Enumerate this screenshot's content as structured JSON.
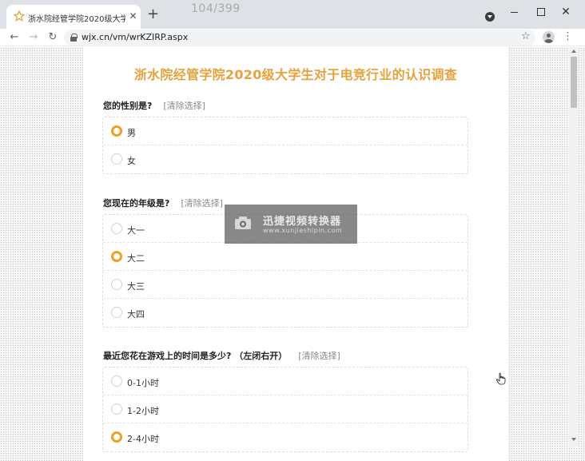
{
  "browser": {
    "tab_title": "浙水院经管学院2020级大学生对...",
    "new_tab_label": "+",
    "frame_counter": "104/399",
    "url": "wjx.cn/vm/wrKZIRP.aspx",
    "icons": [
      "star-favicon-icon",
      "close-icon",
      "back-arrow-icon",
      "forward-arrow-icon",
      "reload-icon",
      "lock-icon",
      "bookmark-star-icon",
      "profile-icon",
      "menu-icon",
      "minimize-icon",
      "maximize-icon",
      "window-close-icon"
    ]
  },
  "survey": {
    "title": "浙水院经管学院2020级大学生对于电竞行业的认识调查",
    "accent_color": "#e6a23c",
    "clear_label": "[清除选择]",
    "questions": [
      {
        "title": "您的性别是?",
        "options": [
          {
            "label": "男",
            "selected": true
          },
          {
            "label": "女",
            "selected": false
          }
        ]
      },
      {
        "title": "您现在的年级是?",
        "options": [
          {
            "label": "大一",
            "selected": false
          },
          {
            "label": "大二",
            "selected": true
          },
          {
            "label": "大三",
            "selected": false
          },
          {
            "label": "大四",
            "selected": false
          }
        ]
      },
      {
        "title": "最近您花在游戏上的时间是多少? （左闭右开）",
        "options": [
          {
            "label": "0-1小时",
            "selected": false
          },
          {
            "label": "1-2小时",
            "selected": false
          },
          {
            "label": "2-4小时",
            "selected": true
          }
        ]
      }
    ]
  },
  "watermark": {
    "title": "迅捷视频转换器",
    "subtitle": "www.xunjieshipin.com"
  }
}
